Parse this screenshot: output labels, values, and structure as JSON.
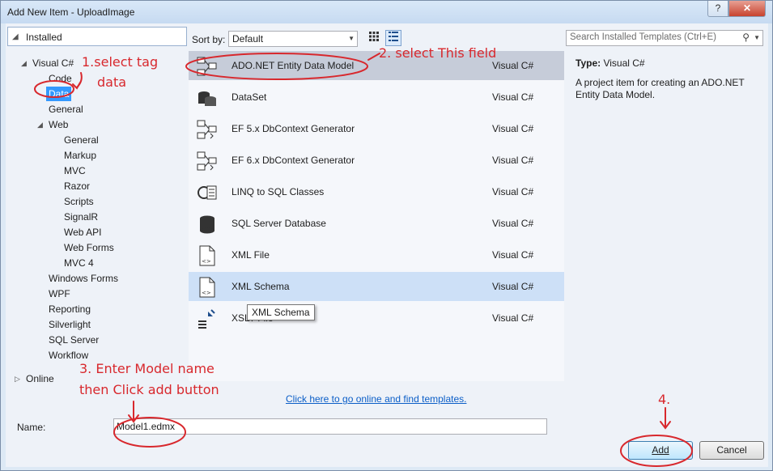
{
  "window": {
    "title": "Add New Item - UploadImage",
    "help_label": "?",
    "close_label": "✕"
  },
  "tree": {
    "header": "Installed",
    "items": [
      {
        "label": "Visual C#",
        "expanded": true
      },
      {
        "label": "Code"
      },
      {
        "label": "Data",
        "selected": true
      },
      {
        "label": "General"
      },
      {
        "label": "Web",
        "expanded": true
      },
      {
        "label": "General"
      },
      {
        "label": "Markup"
      },
      {
        "label": "MVC"
      },
      {
        "label": "Razor"
      },
      {
        "label": "Scripts"
      },
      {
        "label": "SignalR"
      },
      {
        "label": "Web API"
      },
      {
        "label": "Web Forms"
      },
      {
        "label": "MVC 4"
      },
      {
        "label": "Windows Forms"
      },
      {
        "label": "WPF"
      },
      {
        "label": "Reporting"
      },
      {
        "label": "Silverlight"
      },
      {
        "label": "SQL Server"
      },
      {
        "label": "Workflow"
      },
      {
        "label": "Online",
        "expanded": false
      }
    ]
  },
  "sort": {
    "label": "Sort by:",
    "value": "Default"
  },
  "templates": [
    {
      "name": "ADO.NET Entity Data Model",
      "lang": "Visual C#",
      "icon": "entity-model-icon",
      "state": "selected"
    },
    {
      "name": "DataSet",
      "lang": "Visual C#",
      "icon": "dataset-icon"
    },
    {
      "name": "EF 5.x DbContext Generator",
      "lang": "Visual C#",
      "icon": "ef-generator-icon"
    },
    {
      "name": "EF 6.x DbContext Generator",
      "lang": "Visual C#",
      "icon": "ef-generator-icon"
    },
    {
      "name": "LINQ to SQL Classes",
      "lang": "Visual C#",
      "icon": "linq-icon"
    },
    {
      "name": "SQL Server Database",
      "lang": "Visual C#",
      "icon": "database-icon"
    },
    {
      "name": "XML File",
      "lang": "Visual C#",
      "icon": "xml-file-icon"
    },
    {
      "name": "XML Schema",
      "lang": "Visual C#",
      "icon": "xml-schema-icon",
      "state": "hover"
    },
    {
      "name": "XSLT File",
      "lang": "Visual C#",
      "icon": "xslt-icon"
    }
  ],
  "tooltip": "XML Schema",
  "online_link": "Click here to go online and find templates.",
  "search": {
    "placeholder": "Search Installed Templates (Ctrl+E)"
  },
  "details": {
    "type_label": "Type:",
    "type_value": "Visual C#",
    "description": "A project item for creating an ADO.NET Entity Data Model."
  },
  "name_field": {
    "label": "Name:",
    "value": "Model1.edmx"
  },
  "buttons": {
    "add": "Add",
    "cancel": "Cancel"
  },
  "annotations": {
    "step1_line1": "1.select tag",
    "step1_line2": "data",
    "step2": "2. select This field",
    "step3_line1": "3. Enter Model name",
    "step3_line2": "then Click add button",
    "step4": "4."
  },
  "colors": {
    "annotation": "#d8282d",
    "selection": "#3399ff",
    "link": "#0b5ec7"
  }
}
